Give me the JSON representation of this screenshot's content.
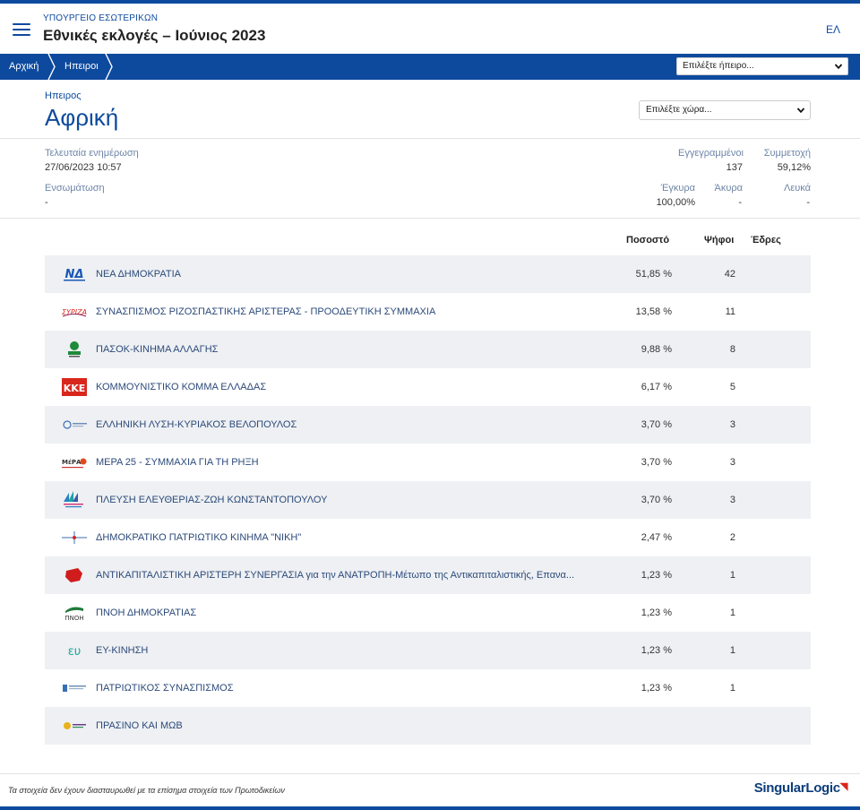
{
  "header": {
    "ministry": "ΥΠΟΥΡΓΕΙΟ ΕΣΩΤΕΡΙΚΩΝ",
    "title": "Εθνικές εκλογές – Ιούνιος 2023",
    "language": "ΕΛ"
  },
  "breadcrumb": {
    "home": "Αρχική",
    "continents": "Ηπειροι"
  },
  "continent_select": {
    "value": "Επιλέξτε ήπειρο..."
  },
  "region": {
    "label": "Ηπειρος",
    "name": "Αφρική"
  },
  "country_select": {
    "value": "Επιλέξτε χώρα..."
  },
  "stats": {
    "last_update_label": "Τελευταία ενημέρωση",
    "last_update_value": "27/06/2023 10:57",
    "integration_label": "Ενσωμάτωση",
    "integration_value": "-",
    "registered_label": "Εγγεγραμμένοι",
    "registered_value": "137",
    "turnout_label": "Συμμετοχή",
    "turnout_value": "59,12%",
    "valid_label": "Έγκυρα",
    "valid_value": "100,00%",
    "invalid_label": "Άκυρα",
    "invalid_value": "-",
    "blank_label": "Λευκά",
    "blank_value": "-"
  },
  "table": {
    "col_percent": "Ποσοστό",
    "col_votes": "Ψήφοι",
    "col_seats": "Έδρες",
    "rows": [
      {
        "name": "ΝΕΑ ΔΗΜΟΚΡΑΤΙΑ",
        "percent": "51,85 %",
        "votes": "42",
        "logo": "nd-logo"
      },
      {
        "name": "ΣΥΝΑΣΠΙΣΜΟΣ ΡΙΖΟΣΠΑΣΤΙΚΗΣ ΑΡΙΣΤΕΡΑΣ - ΠΡΟΟΔΕΥΤΙΚΗ ΣΥΜΜΑΧΙΑ",
        "percent": "13,58 %",
        "votes": "11",
        "logo": "syriza-logo"
      },
      {
        "name": "ΠΑΣΟΚ-ΚΙΝΗΜΑ ΑΛΛΑΓΗΣ",
        "percent": "9,88 %",
        "votes": "8",
        "logo": "pasok-logo"
      },
      {
        "name": "ΚΟΜΜΟΥΝΙΣΤΙΚΟ ΚΟΜΜΑ ΕΛΛΑΔΑΣ",
        "percent": "6,17 %",
        "votes": "5",
        "logo": "kke-logo"
      },
      {
        "name": "ΕΛΛΗΝΙΚΗ ΛΥΣΗ-ΚΥΡΙΑΚΟΣ ΒΕΛΟΠΟΥΛΟΣ",
        "percent": "3,70 %",
        "votes": "3",
        "logo": "elliniki-lysi-logo"
      },
      {
        "name": "ΜΕΡΑ 25 - ΣΥΜΜΑΧΙΑ ΓΙΑ ΤΗ ΡΗΞΗ",
        "percent": "3,70 %",
        "votes": "3",
        "logo": "mera25-logo"
      },
      {
        "name": "ΠΛΕΥΣΗ ΕΛΕΥΘΕΡΙΑΣ-ΖΩΗ ΚΩΝΣΤΑΝΤΟΠΟΥΛΟΥ",
        "percent": "3,70 %",
        "votes": "3",
        "logo": "plefsi-logo"
      },
      {
        "name": "ΔΗΜΟΚΡΑΤΙΚΟ ΠΑΤΡΙΩΤΙΚΟ ΚΙΝΗΜΑ \"ΝΙΚΗ\"",
        "percent": "2,47 %",
        "votes": "2",
        "logo": "niki-logo"
      },
      {
        "name": "ΑΝΤΙΚΑΠΙΤΑΛΙΣΤΙΚΗ ΑΡΙΣΤΕΡΗ ΣΥΝΕΡΓΑΣΙΑ για την ΑΝΑΤΡΟΠΗ-Μέτωπο της Αντικαπιταλιστικής, Επανα...",
        "percent": "1,23 %",
        "votes": "1",
        "logo": "antarsya-logo"
      },
      {
        "name": "ΠΝΟΗ ΔΗΜΟΚΡΑΤΙΑΣ",
        "percent": "1,23 %",
        "votes": "1",
        "logo": "pnoi-logo"
      },
      {
        "name": "ΕΥ-ΚΙΝΗΣΗ",
        "percent": "1,23 %",
        "votes": "1",
        "logo": "ef-kinisi-logo"
      },
      {
        "name": "ΠΑΤΡΙΩΤΙΚΟΣ ΣΥΝΑΣΠΙΣΜΟΣ",
        "percent": "1,23 %",
        "votes": "1",
        "logo": "patriotikos-logo"
      },
      {
        "name": "ΠΡΑΣΙΝΟ ΚΑΙ ΜΩΒ",
        "percent": "",
        "votes": "",
        "logo": "prasino-mov-logo"
      }
    ]
  },
  "footer": {
    "note": "Τα στοιχεία δεν έχουν διασταυρωθεί με τα επίσημα στοιχεία των Πρωτοδικείων",
    "brand": "SingularLogic"
  },
  "colors": {
    "primary": "#0d4a9e",
    "row_stripe": "#eef0f3",
    "label": "#6e86a8"
  }
}
